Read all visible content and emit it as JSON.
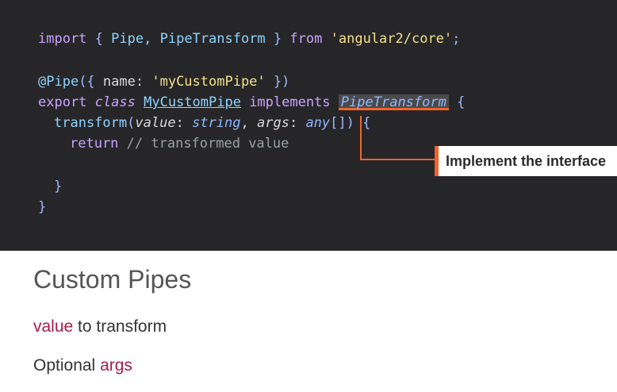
{
  "code": {
    "line1": {
      "import": "import",
      "brace_open": "{",
      "pipe": "Pipe,",
      "pipe_transform": "PipeTransform",
      "brace_close": "}",
      "from": "from",
      "module": "'angular2/core'",
      "semi": ";"
    },
    "line2": {
      "decorator": "@Pipe",
      "open": "({",
      "name_key": "name:",
      "name_value": "'myCustomPipe'",
      "close": "})"
    },
    "line3": {
      "export": "export",
      "class": "class",
      "class_name": "MyCustomPipe",
      "implements": "implements",
      "interface": "PipeTransform",
      "brace": "{"
    },
    "line4": {
      "method": "transform",
      "paren_open": "(",
      "param1": "value",
      "colon1": ":",
      "type1": "string",
      "comma": ",",
      "param2": "args",
      "colon2": ":",
      "type2": "any",
      "rest": "[]) {"
    },
    "line5": {
      "return": "return",
      "comment": "// transformed value"
    },
    "line6": {
      "brace": "}"
    },
    "line7": {
      "brace": "}"
    }
  },
  "callout": {
    "label": "Implement the interface"
  },
  "slide": {
    "title": "Custom Pipes",
    "bullet1": {
      "highlight": "value",
      "text": "to transform"
    },
    "bullet2": {
      "text": "Optional",
      "highlight": "args"
    }
  },
  "colors": {
    "code_background": "#262628",
    "callout_accent": "#f0642a",
    "highlight_text": "#a51c4e"
  }
}
